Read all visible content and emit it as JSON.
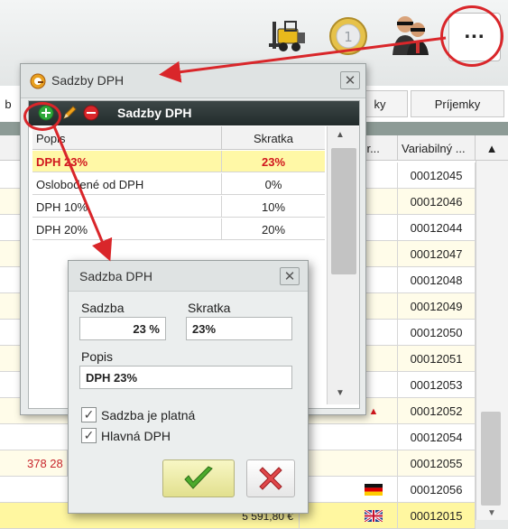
{
  "toolbar": {
    "forklift_icon": "forklift-icon",
    "coin_icon": "euro-coin-icon",
    "agent_icon": "agents-icon",
    "more_label": "..."
  },
  "background": {
    "tabs": [
      "ky",
      "Príjemky"
    ],
    "tab_left_partial": "b",
    "header_partial": "por...",
    "header_variabilny": "Variabilný ...",
    "rows": [
      {
        "variabilny": "00012045"
      },
      {
        "variabilny": "00012046"
      },
      {
        "variabilny": "00012044"
      },
      {
        "variabilny": "00012047"
      },
      {
        "variabilny": "00012048"
      },
      {
        "variabilny": "00012049"
      },
      {
        "variabilny": "00012050"
      },
      {
        "variabilny": "00012051"
      },
      {
        "variabilny": "00012053"
      },
      {
        "variabilny": "00012052"
      },
      {
        "variabilny": "00012054"
      },
      {
        "variabilny": "00012055"
      },
      {
        "variabilny": "00012056"
      },
      {
        "variabilny": "00012015"
      }
    ],
    "partial_amount_red": "378 28",
    "partial_amount_bottom": "5 591,80 €"
  },
  "window1": {
    "title": "Sadzby DPH",
    "toolbar_title": "Sadzby DPH",
    "columns": {
      "popis": "Popis",
      "skratka": "Skratka"
    },
    "rows": [
      {
        "popis": "DPH 23%",
        "skratka": "23%",
        "selected": true
      },
      {
        "popis": "Oslobodené od DPH",
        "skratka": "0%",
        "selected": false
      },
      {
        "popis": "DPH 10%",
        "skratka": "10%",
        "selected": false
      },
      {
        "popis": "DPH 20%",
        "skratka": "20%",
        "selected": false
      }
    ]
  },
  "window2": {
    "title": "Sadzba DPH",
    "sadzba_label": "Sadzba",
    "sadzba_value": "23 %",
    "skratka_label": "Skratka",
    "skratka_value": "23%",
    "popis_label": "Popis",
    "popis_value": "DPH 23%",
    "checkbox_platna": "Sadzba je platná",
    "checkbox_hlavna": "Hlavná DPH"
  },
  "colors": {
    "annotation_red": "#d9262a",
    "selected_row": "#fff8a6",
    "selected_text": "#d0161d",
    "alt_row": "#fffce9"
  }
}
